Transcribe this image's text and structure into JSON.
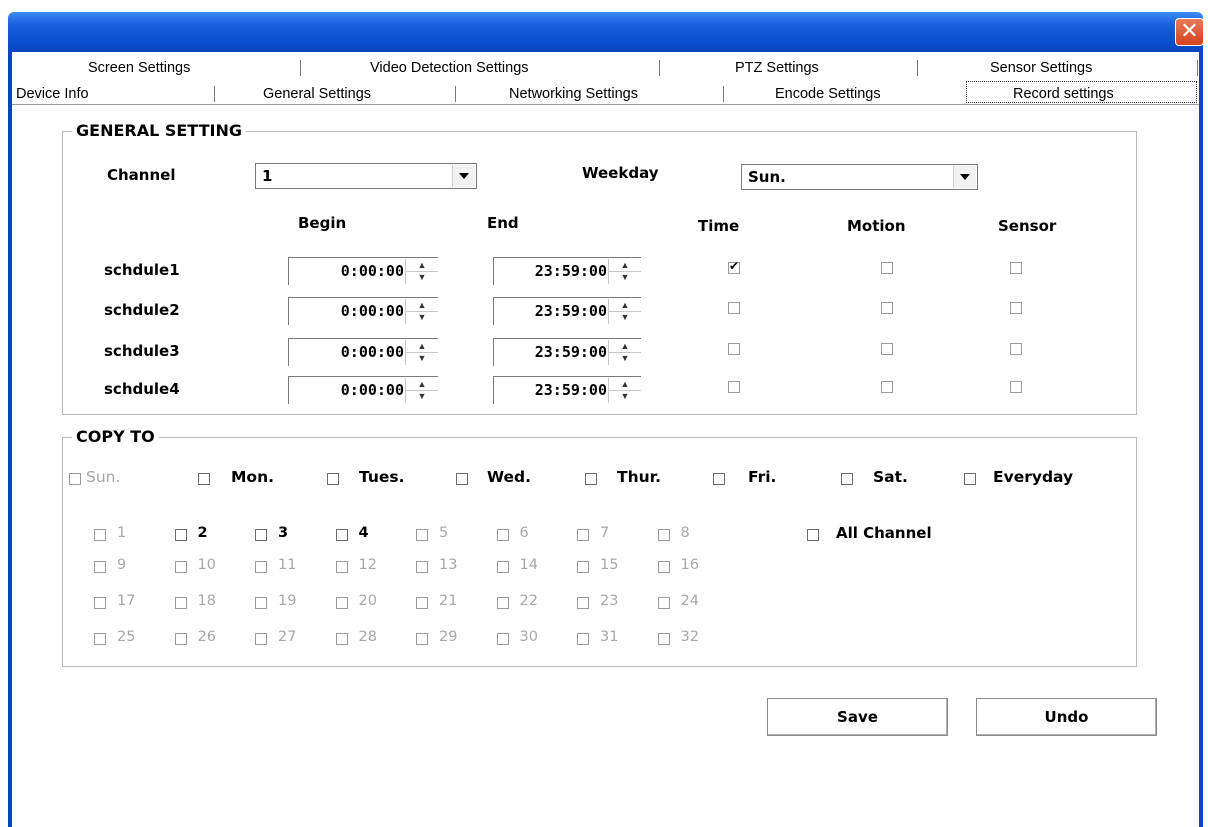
{
  "window": {
    "close_glyph": "✕"
  },
  "tabs_row1": [
    "Screen Settings",
    "Video Detection Settings",
    "PTZ Settings",
    "Sensor Settings"
  ],
  "tabs_row2": [
    "Device Info",
    "General Settings",
    "Networking Settings",
    "Encode Settings",
    "Record settings"
  ],
  "active_tab": "Record settings",
  "general": {
    "title": "GENERAL SETTING",
    "channel_label": "Channel",
    "channel_value": "1",
    "weekday_label": "Weekday",
    "weekday_value": "Sun.",
    "col_begin": "Begin",
    "col_end": "End",
    "col_time": "Time",
    "col_motion": "Motion",
    "col_sensor": "Sensor",
    "schedules": [
      {
        "name": "schdule1",
        "begin": "0:00:00",
        "end": "23:59:00",
        "time": true,
        "motion": false,
        "sensor": false
      },
      {
        "name": "schdule2",
        "begin": "0:00:00",
        "end": "23:59:00",
        "time": false,
        "motion": false,
        "sensor": false
      },
      {
        "name": "schdule3",
        "begin": "0:00:00",
        "end": "23:59:00",
        "time": false,
        "motion": false,
        "sensor": false
      },
      {
        "name": "schdule4",
        "begin": "0:00:00",
        "end": "23:59:00",
        "time": false,
        "motion": false,
        "sensor": false
      }
    ]
  },
  "copy_to": {
    "title": "COPY TO",
    "days": [
      {
        "label": "Sun.",
        "enabled": false
      },
      {
        "label": "Mon.",
        "enabled": true
      },
      {
        "label": "Tues.",
        "enabled": true
      },
      {
        "label": "Wed.",
        "enabled": true
      },
      {
        "label": "Thur.",
        "enabled": true
      },
      {
        "label": "Fri.",
        "enabled": true
      },
      {
        "label": "Sat.",
        "enabled": true
      },
      {
        "label": "Everyday",
        "enabled": true
      }
    ],
    "channels": [
      "1",
      "2",
      "3",
      "4",
      "5",
      "6",
      "7",
      "8",
      "9",
      "10",
      "11",
      "12",
      "13",
      "14",
      "15",
      "16",
      "17",
      "18",
      "19",
      "20",
      "21",
      "22",
      "23",
      "24",
      "25",
      "26",
      "27",
      "28",
      "29",
      "30",
      "31",
      "32"
    ],
    "enabled_channels": [
      "2",
      "3",
      "4"
    ],
    "all_channel_label": "All Channel"
  },
  "buttons": {
    "save": "Save",
    "undo": "Undo"
  },
  "colors": {
    "titlebar": "#0a4fd2",
    "close": "#d2431c",
    "disabled_text": "#a8a8a8"
  },
  "icons": {
    "close": "close-icon",
    "dropdown": "chevron-down-icon",
    "check": "checkmark-icon"
  }
}
